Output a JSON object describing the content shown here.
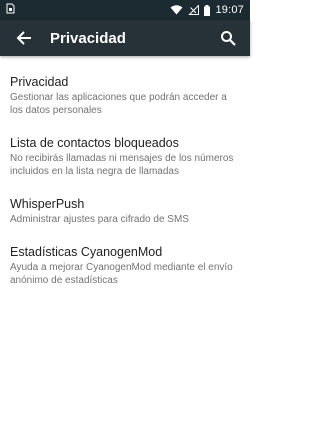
{
  "status_bar": {
    "time": "19:07",
    "icons": [
      "sim-icon",
      "wifi-icon",
      "no-signal-icon",
      "battery-icon"
    ]
  },
  "app_bar": {
    "title": "Privacidad",
    "back_icon": "arrow-back-icon",
    "search_icon": "search-icon",
    "background": "#263238"
  },
  "items": [
    {
      "title": "Privacidad",
      "summary": "Gestionar las aplicaciones que podrán acceder a los datos personales"
    },
    {
      "title": "Lista de contactos bloqueados",
      "summary": "No recibirás llamadas ni mensajes de los números incluidos en la lista negra de llamadas"
    },
    {
      "title": "WhisperPush",
      "summary": "Administrar ajustes para cifrado de SMS"
    },
    {
      "title": "Estadísticas CyanogenMod",
      "summary": "Ayuda a mejorar CyanogenMod mediante el envío anónimo de estadísticas"
    }
  ]
}
